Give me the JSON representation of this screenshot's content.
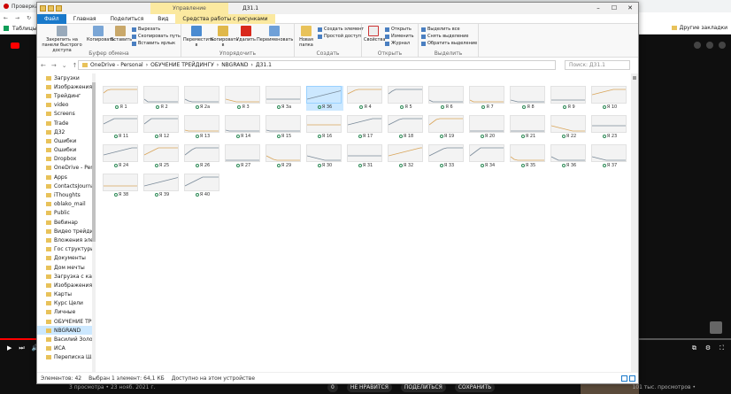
{
  "browser": {
    "tab_title": "Проверка",
    "bookmark": "Таблицы",
    "other_bookmarks": "Другие закладки"
  },
  "youtube": {
    "actions": [
      "0",
      "НЕ НРАВИТСЯ",
      "ПОДЕЛИТЬСЯ",
      "СОХРАНИТЬ"
    ],
    "meta": "3 просмотра • 23 нояб. 2021 г.",
    "side_views": "101 тыс. просмотров •"
  },
  "explorer": {
    "context_tab": "Управление",
    "title": "Д31.1",
    "ribbon_tabs": [
      "Файл",
      "Главная",
      "Поделиться",
      "Вид",
      "Средства работы с рисунками"
    ],
    "groups": {
      "clipboard": "Буфер обмена",
      "organize": "Упорядочить",
      "create": "Создать",
      "open": "Открыть",
      "select": "Выделить"
    },
    "buttons": {
      "pin": "Закрепить на панели быстрого доступа",
      "copy": "Копировать",
      "paste": "Вставить",
      "cut": "Вырезать",
      "copy_path": "Скопировать путь",
      "paste_shortcut": "Вставить ярлык",
      "move": "Переместить в",
      "copy_to": "Копировать в",
      "delete": "Удалить",
      "rename": "Переименовать",
      "new_folder": "Новая папка",
      "new_item": "Создать элемент",
      "easy_access": "Простой доступ",
      "properties": "Свойства",
      "open": "Открыть",
      "edit": "Изменить",
      "history": "Журнал",
      "select_all": "Выделить все",
      "select_none": "Снять выделение",
      "invert": "Обратить выделение"
    },
    "path": [
      "OneDrive - Personal",
      "ОБУЧЕНИЕ ТРЕЙДИНГУ",
      "NBGRAND",
      "Д31.1"
    ],
    "search_placeholder": "Поиск: Д31.1",
    "nav_items": [
      "Загрузки",
      "Изображения",
      "Трейдинг",
      "video",
      "Screens",
      "Trade",
      "Д32",
      "Ошибки",
      "Ошибки",
      "Dropbox",
      "OneDrive - Personal",
      "Apps",
      "ContactsJournal",
      "iThoughts",
      "oblako_mail",
      "Public",
      "Вебинар",
      "Видео трейдинг",
      "Вложения электр",
      "Гос структуры",
      "Документы",
      "Дом мечты",
      "Загрузка с камер",
      "Изображения",
      "Карты",
      "Курс Цели",
      "Личные",
      "ОБУЧЕНИЕ ТРЕЙД",
      "NBGRAND",
      "Василий Золо",
      "ИСА",
      "Переписка Шлаг"
    ],
    "files": [
      "Я 1",
      "Я 2",
      "Я 2а",
      "Я 3",
      "Я 3а",
      "Я 36",
      "Я 4",
      "Я 5",
      "Я 6",
      "Я 7",
      "Я 8",
      "Я 9",
      "Я 10",
      "Я 11",
      "Я 12",
      "Я 13",
      "Я 14",
      "Я 15",
      "Я 16",
      "Я 17",
      "Я 18",
      "Я 19",
      "Я 20",
      "Я 21",
      "Я 22",
      "Я 23",
      "Я 24",
      "Я 25",
      "Я 26",
      "Я 27",
      "Я 29",
      "Я 30",
      "Я 31",
      "Я 32",
      "Я 33",
      "Я 34",
      "Я 35",
      "Я 36",
      "Я 37",
      "Я 38",
      "Я 39",
      "Я 40"
    ],
    "selected_index": 5,
    "status": {
      "count": "Элементов: 42",
      "selected": "Выбран 1 элемент: 64,1 КБ",
      "availability": "Доступно на этом устройстве"
    }
  }
}
